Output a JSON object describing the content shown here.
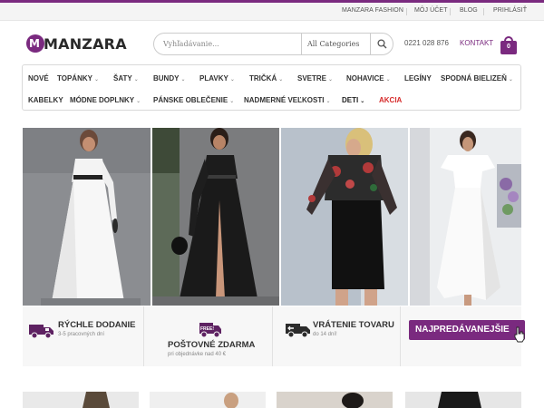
{
  "topbar": {
    "links": [
      "MANZARA FASHION",
      "MÔJ ÚČET",
      "BLOG",
      "PRIHLÁSIŤ"
    ]
  },
  "header": {
    "logo_text": "MANZARA",
    "logo_letter": "M",
    "search_placeholder": "Vyhľadávanie...",
    "search_category": "All Categories",
    "phone": "0221 028 876",
    "contact_label": "KONTAKT",
    "cart_count": "0"
  },
  "nav": {
    "row1": [
      "NOVÉ",
      "TOPÁNKY",
      "ŠATY",
      "BUNDY",
      "PLAVKY",
      "TRIČKÁ",
      "SVETRE",
      "NOHAVICE",
      "LEGÍNY",
      "SPODNÁ BIELIZEŇ"
    ],
    "row2": [
      "KABELKY",
      "MÓDNE DOPLNKY",
      "PÁNSKE OBLEČENIE",
      "NADMERNÉ VEĽKOSTI",
      "DETI",
      "AKCIA"
    ]
  },
  "features": [
    {
      "title": "RÝCHLE DODANIE",
      "subtitle": "3-5 pracovných dní"
    },
    {
      "title": "POŠTOVNÉ ZDARMA",
      "subtitle": "pri objednávke nad 40 €",
      "icon_text": "FREE!"
    },
    {
      "title": "VRÁTENIE TOVARU",
      "subtitle": "do 14 dní!"
    }
  ],
  "bestseller_label": "NAJPREDÁVANEJŠIE",
  "colors": {
    "brand": "#7a2a7f",
    "sale": "#d62b2b",
    "topbar_bg": "#f4f4f4"
  },
  "icons": [
    "search-icon",
    "cart-icon",
    "truck-icon",
    "free-shipping-icon",
    "return-icon",
    "hand-cursor-icon",
    "chevron-down-icon"
  ]
}
